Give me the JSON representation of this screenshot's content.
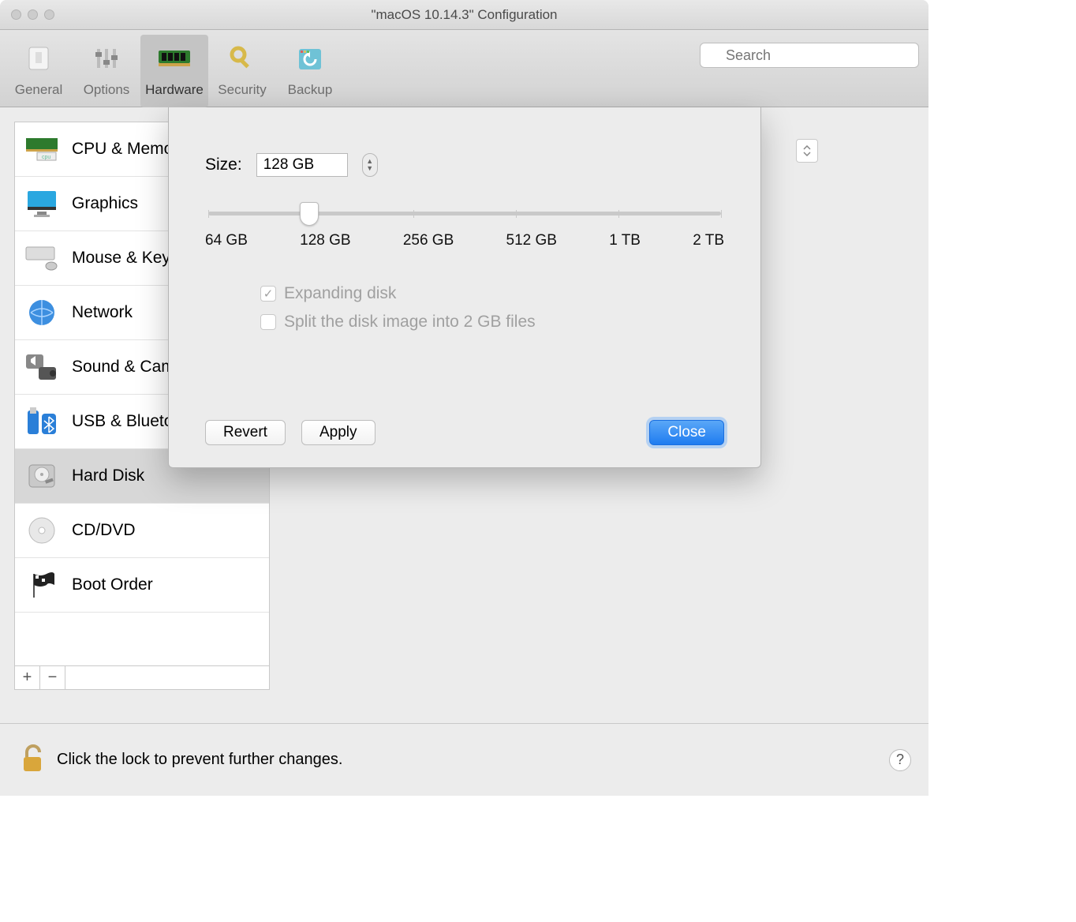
{
  "window": {
    "title": "\"macOS 10.14.3\" Configuration"
  },
  "toolbar": {
    "items": [
      {
        "label": "General"
      },
      {
        "label": "Options"
      },
      {
        "label": "Hardware"
      },
      {
        "label": "Security"
      },
      {
        "label": "Backup"
      }
    ],
    "search_placeholder": "Search"
  },
  "sidebar": {
    "items": [
      {
        "label": "CPU & Memory"
      },
      {
        "label": "Graphics"
      },
      {
        "label": "Mouse & Keyboard"
      },
      {
        "label": "Network"
      },
      {
        "label": "Sound & Camera"
      },
      {
        "label": "USB & Bluetooth"
      },
      {
        "label": "Hard Disk"
      },
      {
        "label": "CD/DVD"
      },
      {
        "label": "Boot Order"
      }
    ],
    "add": "+",
    "remove": "−"
  },
  "sheet": {
    "size_label": "Size:",
    "size_value": "128 GB",
    "slider_ticks": [
      "64 GB",
      "128 GB",
      "256 GB",
      "512 GB",
      "1 TB",
      "2 TB"
    ],
    "expanding_label": "Expanding disk",
    "split_label": "Split the disk image into 2 GB files",
    "revert": "Revert",
    "apply": "Apply",
    "close": "Close"
  },
  "footer": {
    "lock_text": "Click the lock to prevent further changes.",
    "help": "?"
  }
}
